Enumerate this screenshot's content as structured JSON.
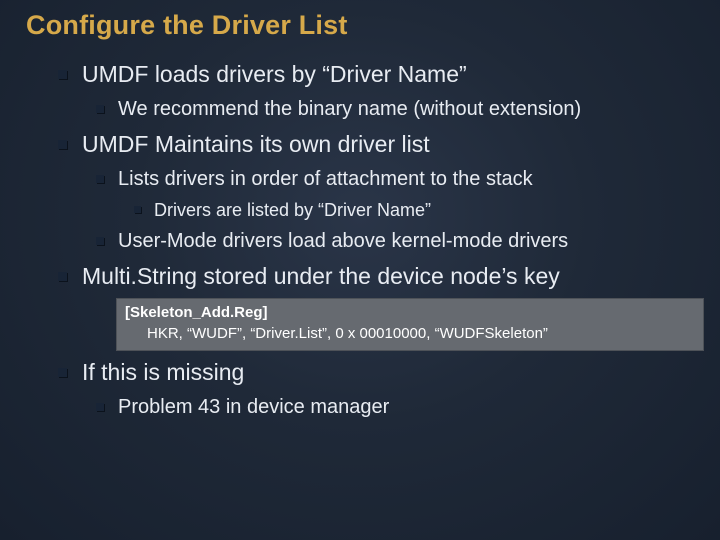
{
  "title": "Configure the Driver List",
  "bullets": {
    "b1": "UMDF loads drivers by “Driver Name”",
    "b1_1": "We recommend the binary name (without extension)",
    "b2": "UMDF Maintains its own driver list",
    "b2_1": "Lists drivers in order of attachment to the stack",
    "b2_1_1": "Drivers are listed by “Driver Name”",
    "b2_2": "User-Mode drivers load above kernel-mode drivers",
    "b3": "Multi.String stored under the device node’s key",
    "code_line1": "[Skeleton_Add.Reg]",
    "code_line2": "HKR,  “WUDF”, “Driver.List”, 0 x 00010000, “WUDFSkeleton”",
    "b4": "If this is missing",
    "b4_1": "Problem 43 in device manager"
  }
}
